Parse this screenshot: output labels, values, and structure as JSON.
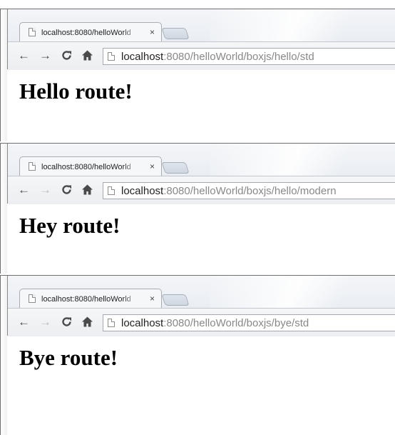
{
  "windows": [
    {
      "tab_title": "localhost:8080/helloWorld",
      "tab_close": "×",
      "forward_enabled": true,
      "url_host": "localhost",
      "url_rest": ":8080/helloWorld/boxjs/hello/std",
      "heading": "Hello route!"
    },
    {
      "tab_title": "localhost:8080/helloWorld",
      "tab_close": "×",
      "forward_enabled": false,
      "url_host": "localhost",
      "url_rest": ":8080/helloWorld/boxjs/hello/modern",
      "heading": "Hey route!"
    },
    {
      "tab_title": "localhost:8080/helloWorld",
      "tab_close": "×",
      "forward_enabled": false,
      "url_host": "localhost",
      "url_rest": ":8080/helloWorld/boxjs/bye/std",
      "heading": "Bye route!"
    }
  ],
  "icons": {
    "back": "←",
    "forward": "→",
    "reload": "reload-icon",
    "home": "home-icon",
    "page": "page-icon"
  }
}
